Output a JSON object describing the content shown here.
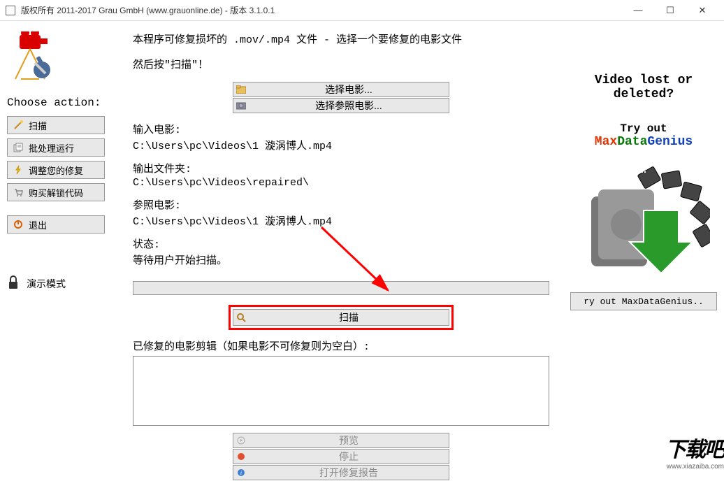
{
  "window": {
    "title": "版权所有 2011-2017 Grau GmbH (www.grauonline.de) - 版本 3.1.0.1"
  },
  "sidebar": {
    "choose_label": "Choose action:",
    "scan": "扫描",
    "batch": "批处理运行",
    "adjust": "调整您的修复",
    "buy": "购买解锁代码",
    "exit": "退出",
    "demo": "演示模式"
  },
  "main": {
    "intro1": "本程序可修复损坏的 .mov/.mp4 文件 - 选择一个要修复的电影文件",
    "intro2": "然后按\"扫描\"！",
    "choose_movie": "选择电影...",
    "choose_ref": "选择参照电影...",
    "input_label": "输入电影:",
    "input_path": "C:\\Users\\pc\\Videos\\1 漩涡博人.mp4",
    "output_label": "输出文件夹:",
    "output_path": "C:\\Users\\pc\\Videos\\repaired\\",
    "ref_label": "参照电影:",
    "ref_path": "C:\\Users\\pc\\Videos\\1 漩涡博人.mp4",
    "status_label": "状态:",
    "status_text": "等待用户开始扫描。",
    "scan_btn": "扫描",
    "clips_label": "已修复的电影剪辑（如果电影不可修复则为空白）:",
    "preview": "预览",
    "stop": "停止",
    "report": "打开修复报告"
  },
  "promo": {
    "h1": "Video lost or",
    "h2": "deleted?",
    "try": "Try out",
    "max": "Max",
    "data": "Data",
    "genius": "Genius",
    "btn": "ry out MaxDataGenius.."
  },
  "watermark": {
    "text": "下载吧",
    "url": "www.xiazaiba.com"
  }
}
